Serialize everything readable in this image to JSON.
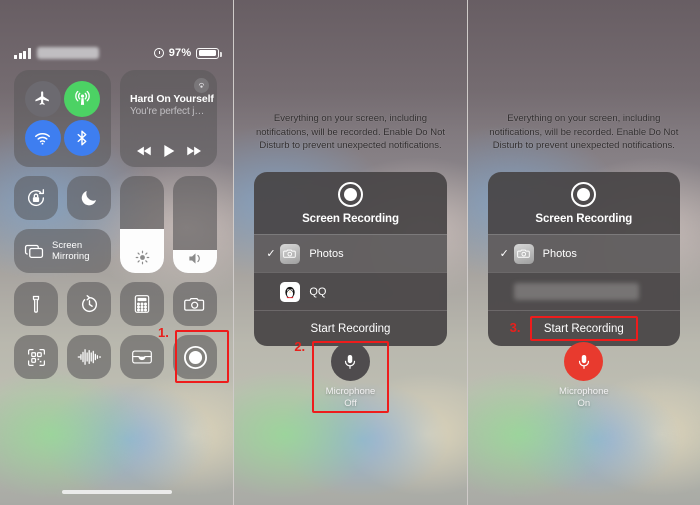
{
  "status_bar": {
    "signal_icon": "cellular-signal-icon",
    "carrier_redacted": true,
    "alarm_icon": "alarm-clock-icon",
    "battery_percent": "97%",
    "battery_level": 97,
    "battery_icon": "battery-icon"
  },
  "control_center": {
    "connectivity": {
      "airplane_mode": {
        "icon": "airplane-icon",
        "state": "off",
        "color": "#6c6a70"
      },
      "cellular_data": {
        "icon": "cellular-data-icon",
        "state": "on",
        "color": "#4cd264"
      },
      "wifi": {
        "icon": "wifi-icon",
        "state": "on",
        "color": "#3e7ef0"
      },
      "bluetooth": {
        "icon": "bluetooth-icon",
        "state": "on",
        "color": "#3e7ef0"
      }
    },
    "now_playing": {
      "title": "Hard On Yourself",
      "subtitle": "You're perfect j…",
      "airplay_icon": "airplay-icon",
      "rewind_icon": "rewind-icon",
      "play_icon": "play-icon",
      "forward_icon": "fast-forward-icon"
    },
    "rotation_lock": {
      "icon": "rotation-lock-icon",
      "state": "off"
    },
    "do_not_disturb": {
      "icon": "moon-icon",
      "state": "off"
    },
    "screen_mirroring": {
      "label_line1": "Screen",
      "label_line2": "Mirroring",
      "icon": "screen-mirroring-icon"
    },
    "brightness": {
      "icon": "brightness-icon",
      "value": 55
    },
    "volume": {
      "icon": "volume-icon",
      "value": 25
    },
    "tiles": [
      {
        "name": "flashlight",
        "icon": "flashlight-icon"
      },
      {
        "name": "timer",
        "icon": "timer-icon"
      },
      {
        "name": "calculator",
        "icon": "calculator-icon"
      },
      {
        "name": "camera",
        "icon": "camera-icon"
      },
      {
        "name": "code-scanner",
        "icon": "qr-code-icon"
      },
      {
        "name": "music-recognition",
        "icon": "shazam-waveform-icon"
      },
      {
        "name": "wallet",
        "icon": "wallet-icon"
      },
      {
        "name": "screen-recording",
        "icon": "record-circle-icon"
      }
    ],
    "home_indicator": "home-indicator"
  },
  "sheet": {
    "notice": "Everything on your screen, including notifications, will be recorded. Enable Do Not Disturb to prevent unexpected notifications.",
    "dialog": {
      "record_icon": "record-circle-icon",
      "title": "Screen Recording",
      "options": [
        {
          "label": "Photos",
          "icon": "photos-app-icon",
          "checked": true
        },
        {
          "label": "QQ",
          "icon": "qq-app-icon",
          "checked": false
        }
      ],
      "action_label": "Start Recording",
      "checkmark": "✓"
    },
    "microphone_off": {
      "icon": "microphone-icon",
      "label_line1": "Microphone",
      "label_line2": "Off",
      "color": "#4f4c4e"
    },
    "microphone_on": {
      "icon": "microphone-icon",
      "label_line1": "Microphone",
      "label_line2": "On",
      "color": "#e83a2e"
    },
    "redacted_option": true
  },
  "annotations": {
    "step1": "1.",
    "step2": "2.",
    "step3": "3.",
    "highlight_color": "#ee1c1c"
  }
}
